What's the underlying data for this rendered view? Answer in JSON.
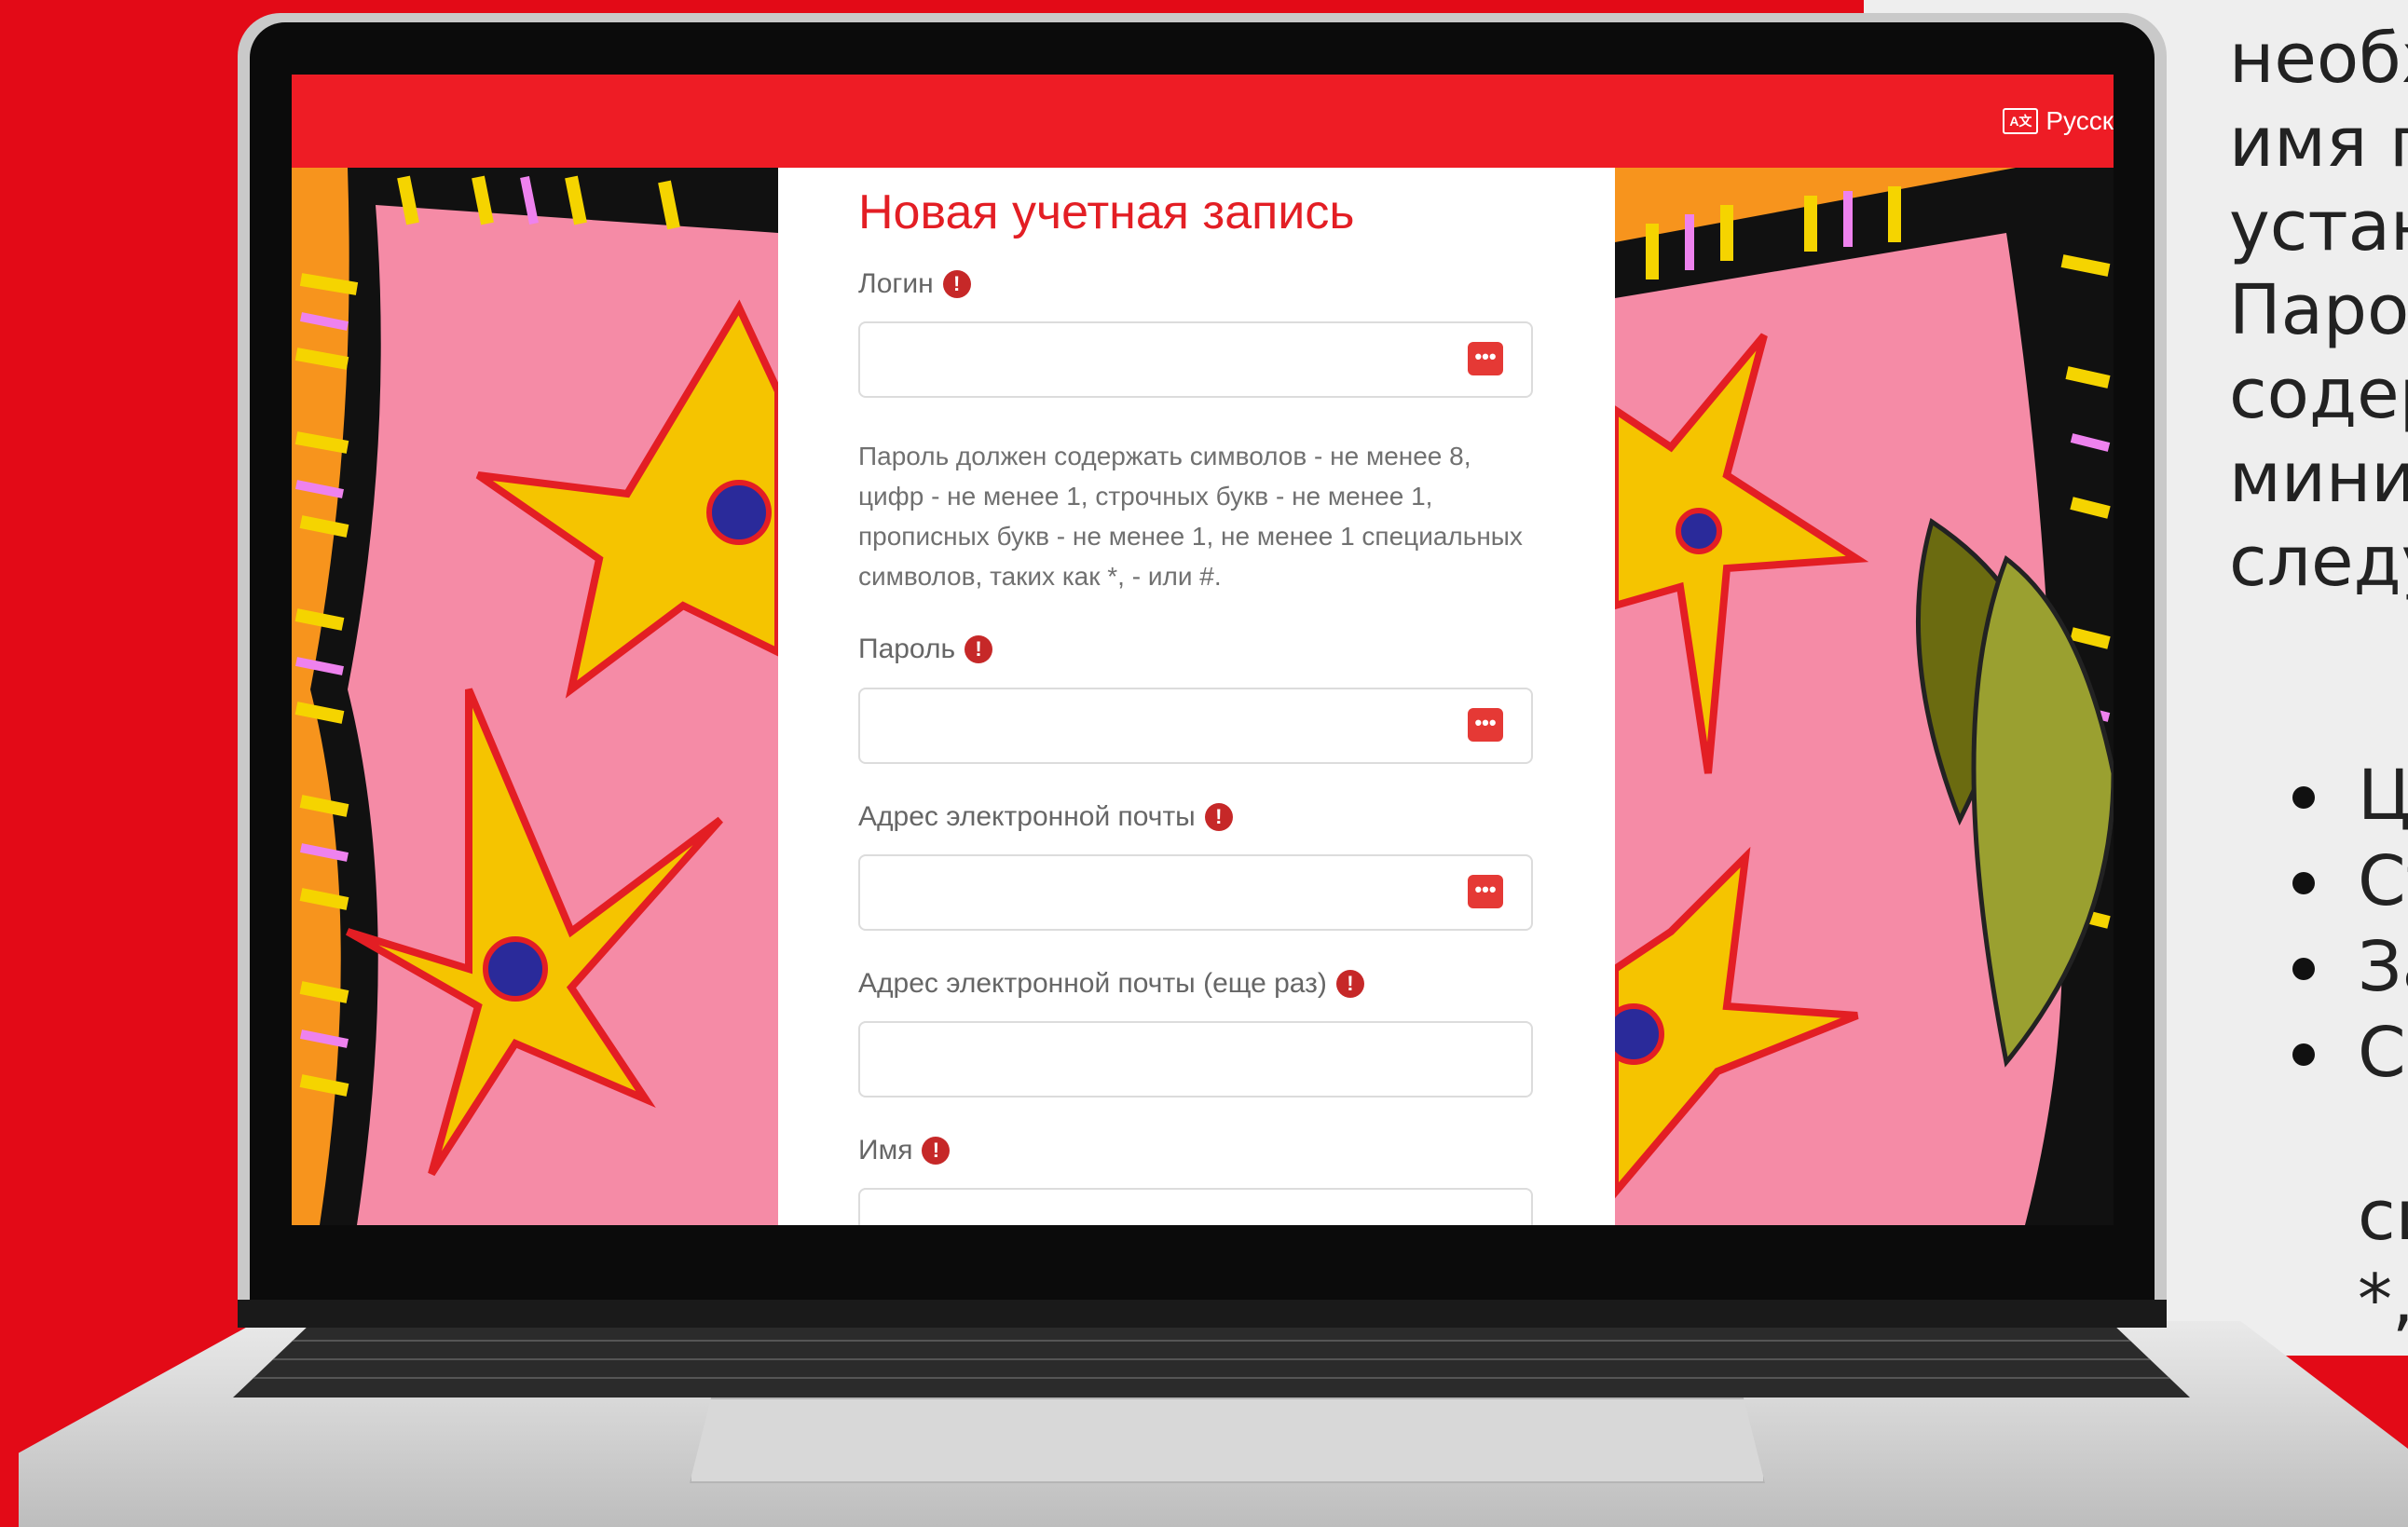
{
  "side_panel": {
    "lines": [
      "необх",
      "имя п",
      "устан",
      "Паро",
      "содер",
      "мини",
      "следу"
    ],
    "bullets": [
      "Ц",
      "Ст",
      "За",
      "Сп",
      "си",
      "*,"
    ]
  },
  "screen": {
    "language": "Русск",
    "language_icon": "translate-icon",
    "form": {
      "title": "Новая учетная запись",
      "login_label": "Логин",
      "password_hint": "Пароль должен содержать символов - не менее 8, цифр - не менее 1, строчных букв - не менее 1, прописных букв - не менее 1, не менее 1 специальных символов, таких как *, - или #.",
      "password_label": "Пароль",
      "email_label": "Адрес электронной почты",
      "email_repeat_label": "Адрес электронной почты (еще раз)",
      "firstname_label": "Имя"
    }
  },
  "colors": {
    "accent": "#e31e24",
    "navbar": "#ee1c25",
    "background": "#e30a17",
    "required": "#c62828"
  }
}
